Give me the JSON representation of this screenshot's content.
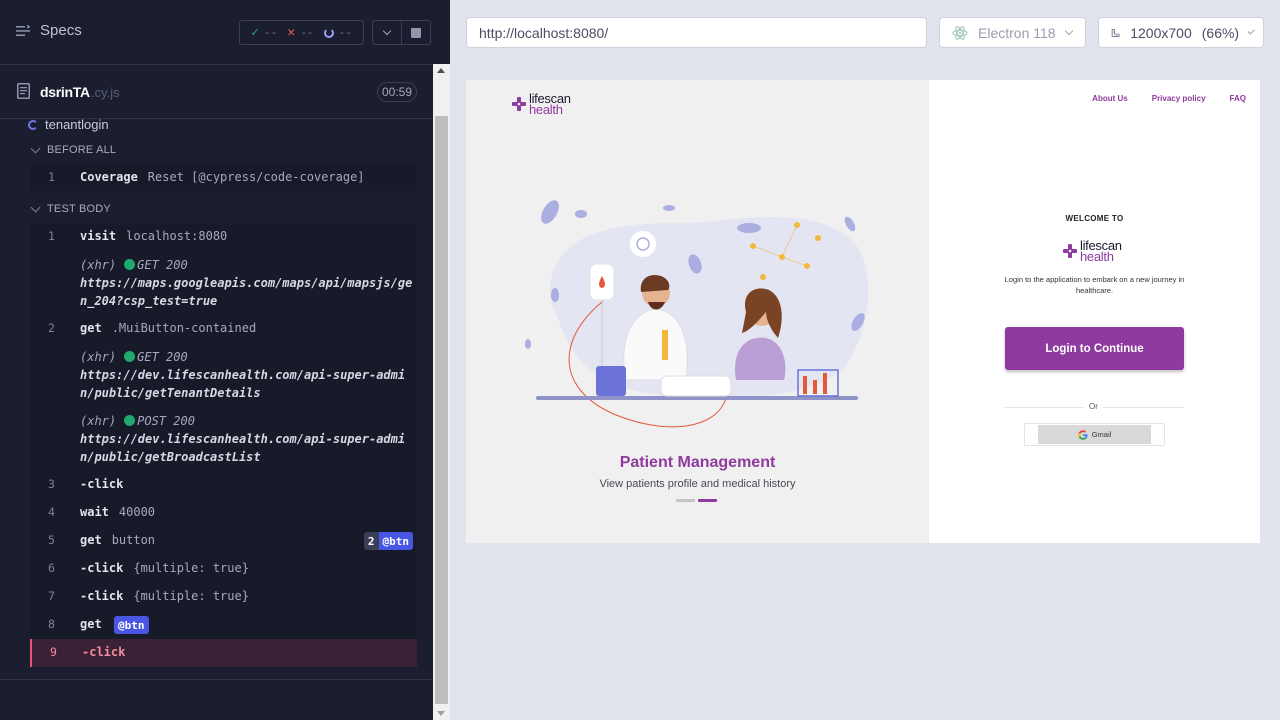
{
  "runner": {
    "specs_label": "Specs",
    "stats": {
      "passed": "--",
      "failed": "--",
      "pending": "--"
    },
    "spec_file": {
      "name": "dsrinTA",
      "ext": ".cy.js",
      "duration": "00:59"
    },
    "suite_title": "tenantlogin",
    "before_all": {
      "label": "BEFORE ALL",
      "commands": [
        {
          "num": "1",
          "name": "Coverage",
          "message": "Reset [@cypress/code-coverage]"
        }
      ]
    },
    "test_body": {
      "label": "TEST BODY",
      "c1": {
        "num": "1",
        "name": "visit",
        "message": "localhost:8080"
      },
      "xhr1": {
        "prefix": "(xhr)",
        "method": "GET 200",
        "url": "https://maps.googleapis.com/maps/api/mapsjs/gen_204?csp_test=true"
      },
      "c2": {
        "num": "2",
        "name": "get",
        "message": ".MuiButton-contained"
      },
      "xhr2": {
        "prefix": "(xhr)",
        "method": "GET 200",
        "url": "https://dev.lifescanhealth.com/api-super-admin/public/getTenantDetails"
      },
      "xhr3": {
        "prefix": "(xhr)",
        "method": "POST 200",
        "url": "https://dev.lifescanhealth.com/api-super-admin/public/getBroadcastList"
      },
      "c3": {
        "num": "3",
        "name": "-click",
        "message": ""
      },
      "c4": {
        "num": "4",
        "name": "wait",
        "message": "40000"
      },
      "c5": {
        "num": "5",
        "name": "get",
        "message": "button",
        "alias_count": "2",
        "alias": "@btn"
      },
      "c6": {
        "num": "6",
        "name": "-click",
        "message": "{multiple: true}"
      },
      "c7": {
        "num": "7",
        "name": "-click",
        "message": "{multiple: true}"
      },
      "c8": {
        "num": "8",
        "name": "get",
        "alias": "@btn"
      },
      "c9": {
        "num": "9",
        "name": "-click"
      }
    }
  },
  "browser": {
    "url": "http://localhost:8080/",
    "browser_name": "Electron 118",
    "viewport": "1200x700",
    "zoom": "(66%)"
  },
  "app": {
    "logo": {
      "line1": "lifescan",
      "line2": "health"
    },
    "nav": [
      "About Us",
      "Privacy policy",
      "FAQ"
    ],
    "slide": {
      "title": "Patient Management",
      "subtitle": "View patients profile and medical history",
      "active_index": 1,
      "count": 2
    },
    "welcome": "WELCOME TO",
    "tagline": "Login to the application to embark on a new journey in healthcare.",
    "login_button": "Login to Continue",
    "or": "Or",
    "gmail": "Gmail",
    "colors": {
      "brand": "#8e3a9e"
    }
  }
}
